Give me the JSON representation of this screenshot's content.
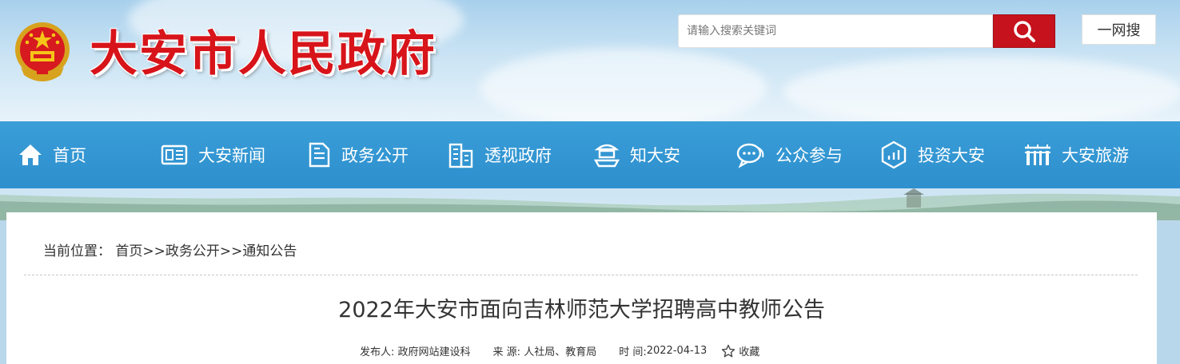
{
  "header": {
    "site_title": "大安市人民政府",
    "search_placeholder": "请输入搜索关键词",
    "search_icon": "magnifier-icon",
    "yiwang_label": "一网搜",
    "brand_red": "#c6121c"
  },
  "nav": {
    "bg_color": "#2d8fcd",
    "items": [
      {
        "label": "首页",
        "icon": "home-icon"
      },
      {
        "label": "大安新闻",
        "icon": "news-icon"
      },
      {
        "label": "政务公开",
        "icon": "document-icon"
      },
      {
        "label": "透视政府",
        "icon": "building-icon"
      },
      {
        "label": "知大安",
        "icon": "landmark-icon"
      },
      {
        "label": "公众参与",
        "icon": "chat-icon"
      },
      {
        "label": "投资大安",
        "icon": "investment-icon"
      },
      {
        "label": "大安旅游",
        "icon": "gate-icon"
      }
    ]
  },
  "breadcrumb": {
    "prefix": "当前位置：",
    "items": [
      "首页",
      "政务公开",
      "通知公告"
    ],
    "separator": ">>"
  },
  "article": {
    "title": "2022年大安市面向吉林师范大学招聘高中教师公告",
    "publisher_label": "发布人:",
    "publisher": "政府网站建设科",
    "source_label": "来 源:",
    "source": "人社局、教育局",
    "time_label": "时 间:",
    "time": "2022-04-13",
    "favorite_label": "收藏",
    "favorite_icon": "star-icon"
  }
}
